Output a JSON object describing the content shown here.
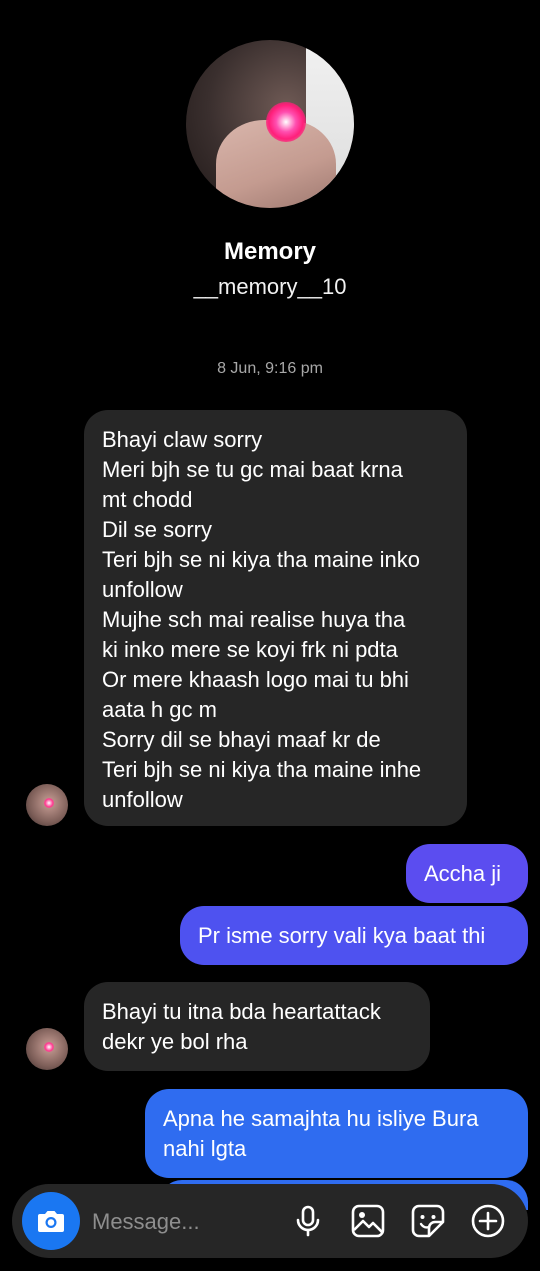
{
  "profile": {
    "name": "Memory",
    "username": "__memory__10"
  },
  "timestamp": "8 Jun, 9:16 pm",
  "messages": [
    {
      "text": "Bhayi claw sorry\nMeri bjh se tu gc mai baat krna\nmt chodd\nDil se sorry\nTeri bjh se ni kiya tha maine inko\nunfollow\nMujhe sch mai realise huya tha\nki inko mere se koyi frk ni pdta\nOr mere khaash logo mai tu bhi\naata h gc m\nSorry dil se bhayi maaf kr de\nTeri bjh se ni kiya tha maine inhe\nunfollow"
    },
    {
      "text": "Accha ji"
    },
    {
      "text": "Pr isme sorry vali kya baat thi"
    },
    {
      "text": "Bhayi tu itna bda heartattack\ndekr ye bol rha"
    },
    {
      "text": "Apna he samajhta hu isliye Bura\nnahi lgta"
    }
  ],
  "composer": {
    "placeholder": "Message..."
  },
  "icons": {
    "camera": "camera-icon",
    "mic": "microphone-icon",
    "gallery": "gallery-icon",
    "sticker": "sticker-icon",
    "add": "add-icon"
  },
  "colors": {
    "background": "#000000",
    "incoming_bubble": "#262626",
    "outgoing_purple": "#5b4df0",
    "outgoing_blue": "#2f6cf0",
    "camera_button": "#1a77f2"
  }
}
